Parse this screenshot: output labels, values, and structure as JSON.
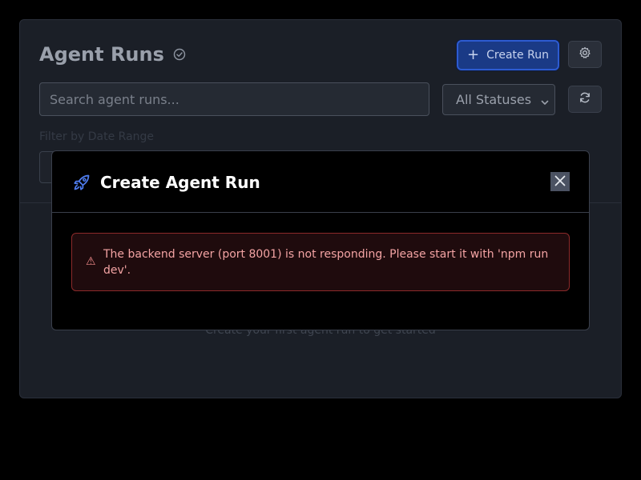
{
  "header": {
    "title": "Agent Runs",
    "create_button_label": "Create Run",
    "create_button_icon": "plus-icon",
    "settings_icon": "gear-icon",
    "title_badge_icon": "check-circle-icon"
  },
  "filters": {
    "search_placeholder": "Search agent runs...",
    "status_selected": "All Statuses",
    "refresh_icon": "refresh-icon",
    "date_range_label": "Filter by Date Range"
  },
  "empty_state": {
    "text": "Create your first agent run to get started"
  },
  "modal": {
    "title": "Create Agent Run",
    "title_icon": "rocket-icon",
    "close_icon": "close-icon",
    "error_icon": "warning-icon",
    "error_message": "The backend server (port 8001) is not responding. Please start it with 'npm run dev'."
  },
  "colors": {
    "accent": "#2d5bd1",
    "error_border": "#8c2a2a",
    "error_text": "#f3a3a3",
    "rocket": "#4f7df0"
  }
}
